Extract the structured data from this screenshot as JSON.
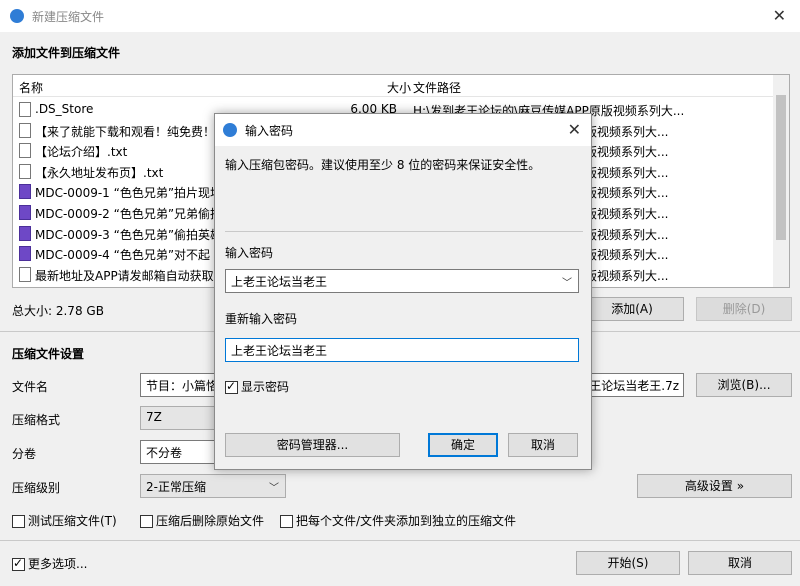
{
  "window": {
    "title": "新建压缩文件"
  },
  "add_files": {
    "section_title": "添加文件到压缩文件",
    "columns": {
      "name": "名称",
      "size": "大小",
      "path": "文件路径"
    },
    "files": [
      {
        "name": ".DS_Store",
        "size": "6.00 KB",
        "path": "H:\\发到老王论坛的\\麻豆传媒APP原版视频系列大...",
        "icon": "txt"
      },
      {
        "name": "【来了就能下载和观看！纯免费！",
        "size": "",
        "path": "原版视频系列大...",
        "icon": "txt"
      },
      {
        "name": "【论坛介绍】.txt",
        "size": "",
        "path": "原版视频系列大...",
        "icon": "txt"
      },
      {
        "name": "【永久地址发布页】.txt",
        "size": "",
        "path": "原版视频系列大...",
        "icon": "txt"
      },
      {
        "name": "MDC-0009-1 “色色兄弟”拍片现场",
        "size": "",
        "path": "原版视频系列大...",
        "icon": "mp4"
      },
      {
        "name": "MDC-0009-2 “色色兄弟”兄弟偷拍",
        "size": "",
        "path": "原版视频系列大...",
        "icon": "mp4"
      },
      {
        "name": "MDC-0009-3 “色色兄弟”偷拍英雄",
        "size": "",
        "path": "原版视频系列大...",
        "icon": "mp4"
      },
      {
        "name": "MDC-0009-4 “色色兄弟”对不起 我",
        "size": "",
        "path": "原版视频系列大...",
        "icon": "mp4"
      },
      {
        "name": "最新地址及APP请发邮箱自动获取!",
        "size": "",
        "path": "原版视频系列大...",
        "icon": "txt"
      }
    ],
    "total_size": "总大小: 2.78 GB",
    "add_button": "添加(A)",
    "delete_button": "删除(D)"
  },
  "settings": {
    "section_title": "压缩文件设置",
    "filename_label": "文件名",
    "filename_value": "节目：小篇恪",
    "filename_tail": "王论坛当老王.7z",
    "browse_button": "浏览(B)...",
    "format_label": "压缩格式",
    "format_value": "7Z",
    "split_label": "分卷",
    "split_value": "不分卷",
    "level_label": "压缩级别",
    "level_value": "2-正常压缩",
    "advanced_button": "高级设置 »",
    "test_label": "测试压缩文件(T)",
    "delete_after_label": "压缩后删除原始文件",
    "separate_label": "把每个文件/文件夹添加到独立的压缩文件",
    "more_options_label": "更多选项...",
    "start_button": "开始(S)",
    "cancel_button": "取消"
  },
  "password_dialog": {
    "title": "输入密码",
    "hint": "输入压缩包密码。建议使用至少 8 位的密码来保证安全性。",
    "password_label": "输入密码",
    "password_value": "上老王论坛当老王",
    "confirm_label": "重新输入密码",
    "confirm_value": "上老王论坛当老王",
    "show_password_label": "显示密码",
    "manager_button": "密码管理器...",
    "ok_button": "确定",
    "cancel_button": "取消"
  },
  "colors": {
    "accent": "#0078d7",
    "mp4_icon": "#6e48c6",
    "app_icon": "#2f7dd6"
  }
}
